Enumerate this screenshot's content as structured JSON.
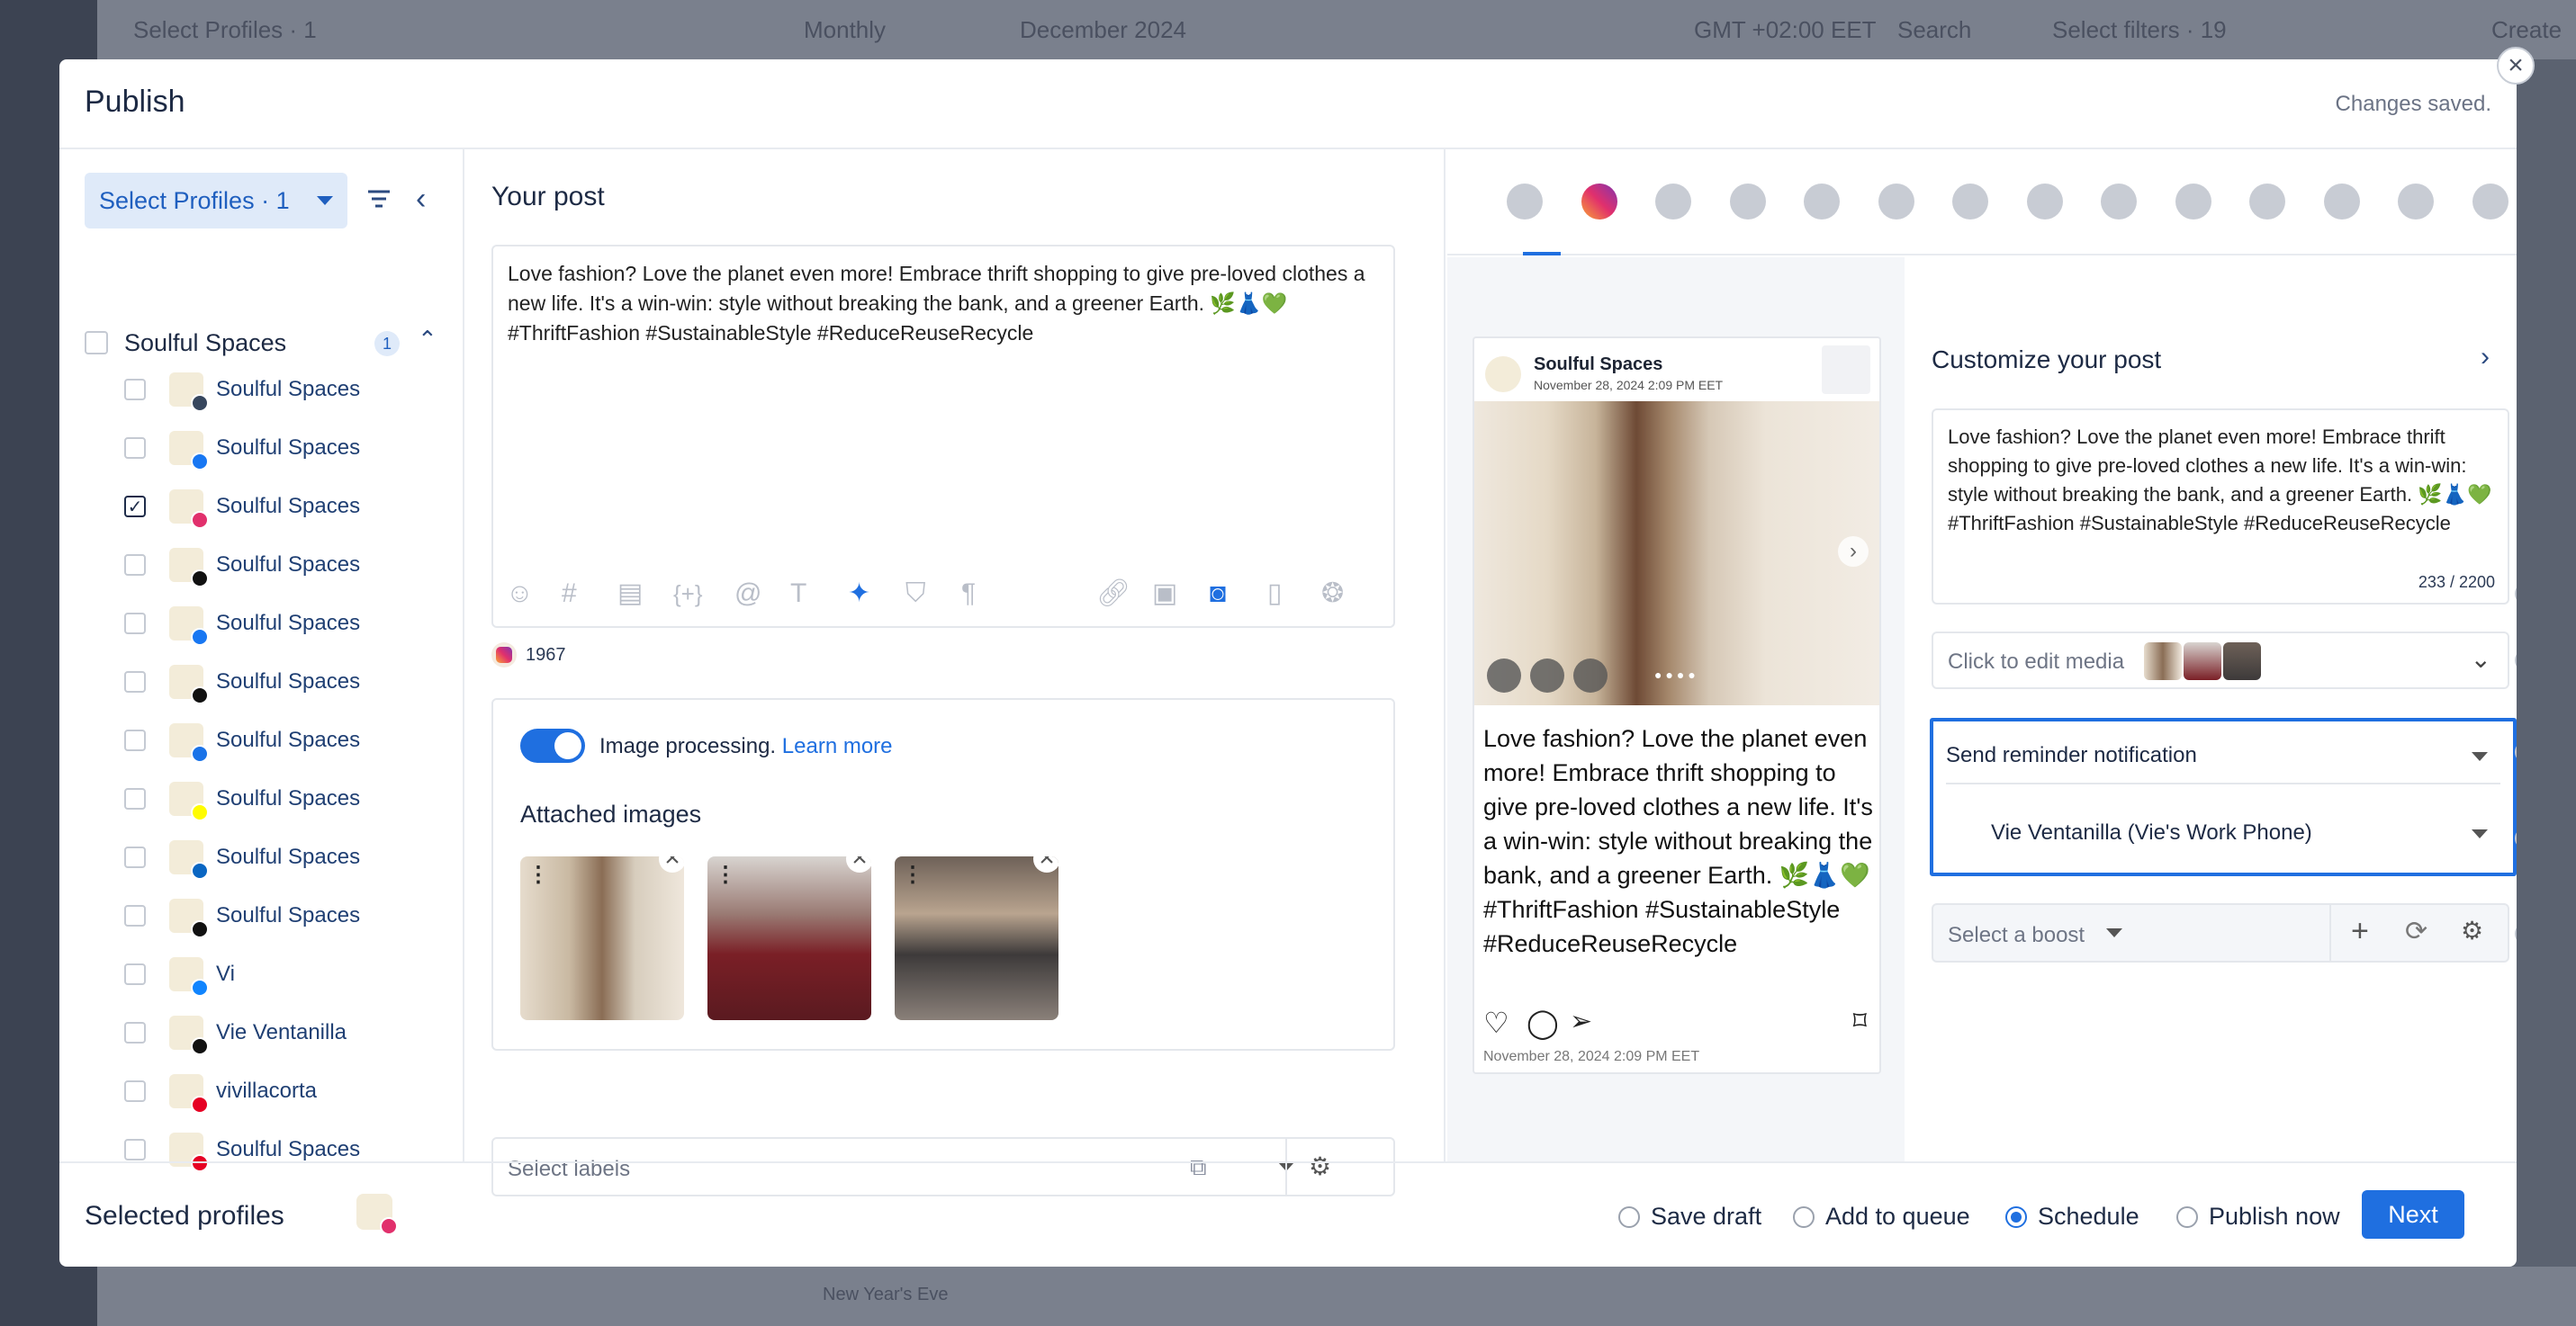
{
  "background": {
    "top_left": "Select Profiles · 1",
    "view": "Monthly",
    "month": "December 2024",
    "timezone": "GMT +02:00 EET",
    "search": "Search",
    "filters": "Select filters · 19",
    "create": "Create",
    "event": "New Year's Eve"
  },
  "modal": {
    "title": "Publish",
    "status": "Changes saved.",
    "close_icon": "close-icon"
  },
  "left": {
    "select_profiles": "Select Profiles · 1",
    "group": {
      "name": "Soulful Spaces",
      "count": "1"
    },
    "profiles": [
      {
        "name": "Soulful Spaces",
        "network": "tumblr",
        "checked": false,
        "badge_color": "#36465d"
      },
      {
        "name": "Soulful Spaces",
        "network": "facebook",
        "checked": false,
        "badge_color": "#1877f2"
      },
      {
        "name": "Soulful Spaces",
        "network": "instagram",
        "checked": true,
        "badge_color": "#e1306c"
      },
      {
        "name": "Soulful Spaces",
        "network": "x",
        "checked": false,
        "badge_color": "#111111"
      },
      {
        "name": "Soulful Spaces",
        "network": "facebook",
        "checked": false,
        "badge_color": "#1877f2"
      },
      {
        "name": "Soulful Spaces",
        "network": "tiktok",
        "checked": false,
        "badge_color": "#111111"
      },
      {
        "name": "Soulful Spaces",
        "network": "google-business",
        "checked": false,
        "badge_color": "#1a73e8"
      },
      {
        "name": "Soulful Spaces",
        "network": "snapchat",
        "checked": false,
        "badge_color": "#fffc00"
      },
      {
        "name": "Soulful Spaces",
        "network": "linkedin",
        "checked": false,
        "badge_color": "#0a66c2"
      },
      {
        "name": "Soulful Spaces",
        "network": "threads",
        "checked": false,
        "badge_color": "#111111"
      },
      {
        "name": "Vi",
        "network": "bluesky",
        "checked": false,
        "badge_color": "#1185fe"
      },
      {
        "name": "Vie Ventanilla",
        "network": "x",
        "checked": false,
        "badge_color": "#111111"
      },
      {
        "name": "vivillacorta",
        "network": "pinterest",
        "checked": false,
        "badge_color": "#e60023"
      },
      {
        "name": "Soulful Spaces",
        "network": "pinterest",
        "checked": false,
        "badge_color": "#e60023"
      }
    ]
  },
  "post": {
    "title": "Your post",
    "text": "Love fashion? Love the planet even more! Embrace thrift shopping to give pre-loved clothes a new life. It's a win-win: style without breaking the bank, and a greener Earth. 🌿👗💚 #ThriftFashion #SustainableStyle #ReduceReuseRecycle",
    "char_remaining": "1967",
    "image_processing_label": "Image processing.",
    "learn_more": "Learn more",
    "attached_title": "Attached images",
    "labels_placeholder": "Select labels"
  },
  "preview": {
    "networks": [
      "facebook",
      "instagram",
      "linkedin",
      "x",
      "youtube",
      "google-business",
      "reddit",
      "pinterest",
      "tiktok",
      "snapchat",
      "bluesky",
      "tumblr",
      "threads",
      "bluesky-butterfly"
    ],
    "active_network": "instagram",
    "account": "Soulful Spaces",
    "date": "November 28, 2024 2:09 PM EET",
    "caption": "Love fashion? Love the planet even more! Embrace thrift shopping to give pre-loved clothes a new life. It's a win-win: style without breaking the bank, and a greener Earth. 🌿👗💚 #ThriftFashion #SustainableStyle #ReduceReuseRecycle",
    "footer_date": "November 28, 2024 2:09 PM EET"
  },
  "customize": {
    "title": "Customize your post",
    "text": "Love fashion? Love the planet even more! Embrace thrift shopping to give pre-loved clothes a new life. It's a win-win: style without breaking the bank, and a greener Earth. 🌿👗💚 #ThriftFashion #SustainableStyle #ReduceReuseRecycle",
    "count": "233 / 2200",
    "media_label": "Click to edit media",
    "reminder": "Send reminder notification",
    "device": "Vie Ventanilla (Vie's Work Phone)",
    "boost_placeholder": "Select a boost"
  },
  "footer": {
    "selected_profiles": "Selected profiles",
    "options": [
      {
        "label": "Save draft",
        "selected": false
      },
      {
        "label": "Add to queue",
        "selected": false
      },
      {
        "label": "Schedule",
        "selected": true
      },
      {
        "label": "Publish now",
        "selected": false
      }
    ],
    "next": "Next"
  },
  "colors": {
    "accent": "#1f6fe0",
    "text": "#1d2a44"
  }
}
